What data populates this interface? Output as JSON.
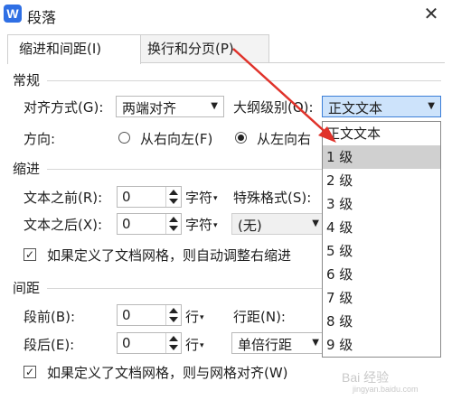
{
  "window": {
    "title": "段落",
    "app_icon_letter": "W",
    "close_glyph": "✕"
  },
  "tabs": [
    {
      "label": "缩进和间距(I)",
      "active": true
    },
    {
      "label": "换行和分页(P)",
      "active": false
    }
  ],
  "general": {
    "heading": "常规",
    "alignment_label": "对齐方式(G):",
    "alignment_value": "两端对齐",
    "outline_label": "大纲级别(O):",
    "outline_value": "正文文本",
    "direction_label": "方向:",
    "direction_rtl": "从右向左(F)",
    "direction_ltr": "从左向右",
    "direction_selected": "ltr"
  },
  "indent": {
    "heading": "缩进",
    "before_label": "文本之前(R):",
    "before_value": "0",
    "before_unit": "字符",
    "after_label": "文本之后(X):",
    "after_value": "0",
    "after_unit": "字符",
    "special_label": "特殊格式(S):",
    "special_value": "(无)",
    "auto_adjust_label": "如果定义了文档网格，则自动调整右缩进",
    "auto_adjust_checked": true
  },
  "spacing": {
    "heading": "间距",
    "before_label": "段前(B):",
    "before_value": "0",
    "before_unit": "行",
    "after_label": "段后(E):",
    "after_value": "0",
    "after_unit": "行",
    "line_label": "行距(N):",
    "line_value": "单倍行距",
    "snap_grid_label": "如果定义了文档网格，则与网格对齐(W)",
    "snap_grid_checked": true
  },
  "outline_dropdown": {
    "options": [
      "正文文本",
      "1 级",
      "2 级",
      "3 级",
      "4 级",
      "5 级",
      "6 级",
      "7 级",
      "8 级",
      "9 级"
    ],
    "hovered": "1 级"
  },
  "glyphs": {
    "check": "✓",
    "dropdown_arrow": "▼",
    "unit_caret": "▾"
  },
  "annotation": {
    "color": "#e0322a"
  },
  "watermark": {
    "text": "Bai 经验",
    "sub": "jingyan.baidu.com"
  }
}
